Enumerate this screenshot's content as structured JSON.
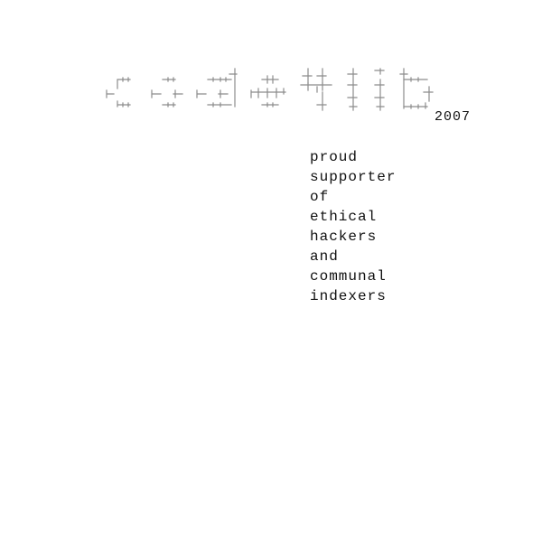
{
  "logo": {
    "text": "code4lib",
    "style": "ascii-box-drawing",
    "color": "#8c8c8c"
  },
  "year": "2007",
  "tagline": [
    "proud",
    "supporter",
    "of",
    "ethical",
    "hackers",
    "and",
    "communal",
    "indexers"
  ]
}
